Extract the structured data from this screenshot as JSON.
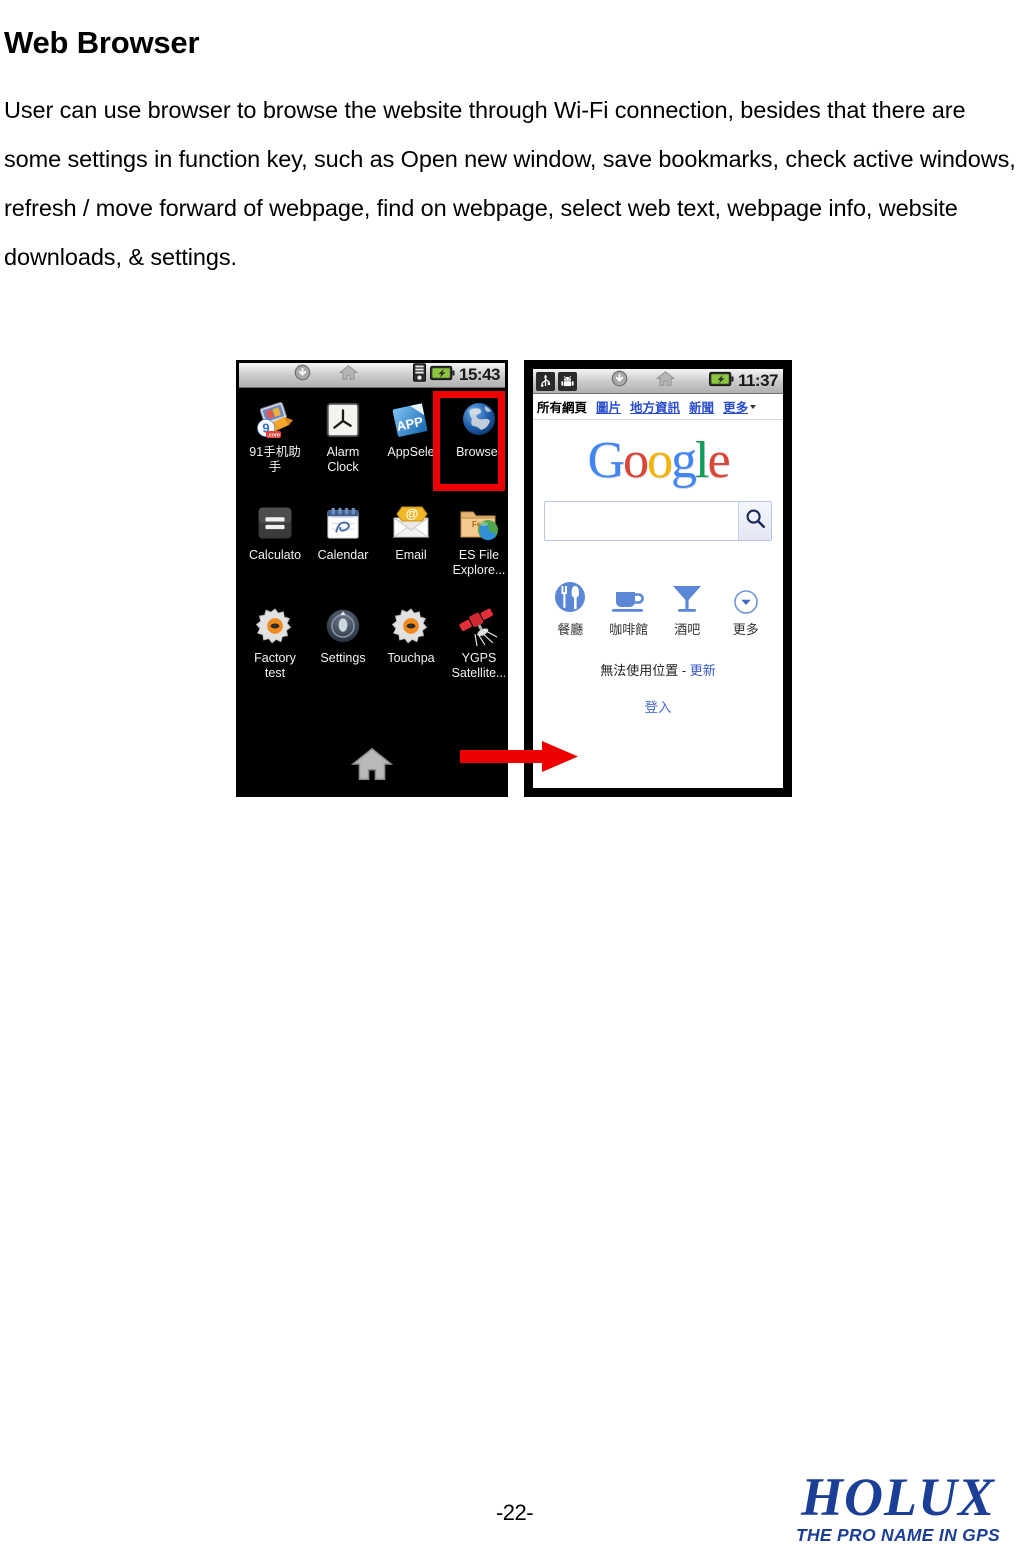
{
  "document": {
    "heading": "Web Browser",
    "paragraph": "User can use browser to browse the website through Wi-Fi connection, besides that there are some settings in function key, such as Open new window, save bookmarks, check active windows, refresh / move forward of webpage, find on webpage, select web text, webpage info, website downloads, & settings.",
    "page_number": "-22-"
  },
  "brand": {
    "name": "HOLUX",
    "tagline": "THE PRO NAME IN GPS",
    "color": "#1b3f96"
  },
  "figure": {
    "highlight_color": "#ee0000",
    "arrow_color": "#ee0000",
    "arrow_name": "red-flow-arrow"
  },
  "phone_left": {
    "statusbar": {
      "icons": [
        "download-icon",
        "home-icon",
        "sd-storage-icon",
        "battery-charging-icon"
      ],
      "clock": "15:43"
    },
    "apps": [
      {
        "label": "91手机助\n手",
        "icon": "91-assistant-icon",
        "highlighted": false
      },
      {
        "label": "Alarm\nClock",
        "icon": "alarm-clock-icon",
        "highlighted": false
      },
      {
        "label": "AppSele",
        "icon": "app-selector-icon",
        "highlighted": false
      },
      {
        "label": "Browser",
        "icon": "globe-browser-icon",
        "highlighted": true
      },
      {
        "label": "Calculato",
        "icon": "calculator-icon",
        "highlighted": false
      },
      {
        "label": "Calendar",
        "icon": "calendar-icon",
        "highlighted": false
      },
      {
        "label": "Email",
        "icon": "email-envelope-icon",
        "highlighted": false
      },
      {
        "label": "ES File\nExplore...",
        "icon": "es-file-explorer-icon",
        "highlighted": false
      },
      {
        "label": "Factory\ntest",
        "icon": "factory-test-gear-icon",
        "highlighted": false
      },
      {
        "label": "Settings",
        "icon": "settings-dial-icon",
        "highlighted": false
      },
      {
        "label": "Touchpa",
        "icon": "touchpad-gear-icon",
        "highlighted": false
      },
      {
        "label": "YGPS\nSatellite...",
        "icon": "gps-satellite-icon",
        "highlighted": false
      }
    ],
    "dock": {
      "home_icon": "home-icon"
    }
  },
  "phone_right": {
    "statusbar": {
      "icons": [
        "usb-icon",
        "android-debug-icon",
        "download-icon",
        "home-icon",
        "battery-charging-icon"
      ],
      "clock": "11:37"
    },
    "google": {
      "nav": [
        {
          "label": "所有網頁",
          "current": true
        },
        {
          "label": "圖片",
          "current": false
        },
        {
          "label": "地方資訊",
          "current": false
        },
        {
          "label": "新聞",
          "current": false
        },
        {
          "label": "更多",
          "current": false
        }
      ],
      "logo_letters": [
        {
          "char": "G",
          "color": "#4285F4"
        },
        {
          "char": "o",
          "color": "#DB4437"
        },
        {
          "char": "o",
          "color": "#F4B400"
        },
        {
          "char": "g",
          "color": "#4285F4"
        },
        {
          "char": "l",
          "color": "#0F9D58"
        },
        {
          "char": "e",
          "color": "#DB4437"
        }
      ],
      "search": {
        "value": "",
        "placeholder": "",
        "button_icon": "search-icon"
      },
      "shortcuts": [
        {
          "label": "餐廳",
          "icon": "restaurant-icon"
        },
        {
          "label": "咖啡館",
          "icon": "cafe-cup-icon"
        },
        {
          "label": "酒吧",
          "icon": "bar-cocktail-icon"
        },
        {
          "label": "更多",
          "icon": "more-chevron-icon"
        }
      ],
      "location_status": "無法使用位置 -",
      "location_refresh": "更新",
      "sign_in": "登入",
      "accent_color": "#3355cc"
    }
  }
}
